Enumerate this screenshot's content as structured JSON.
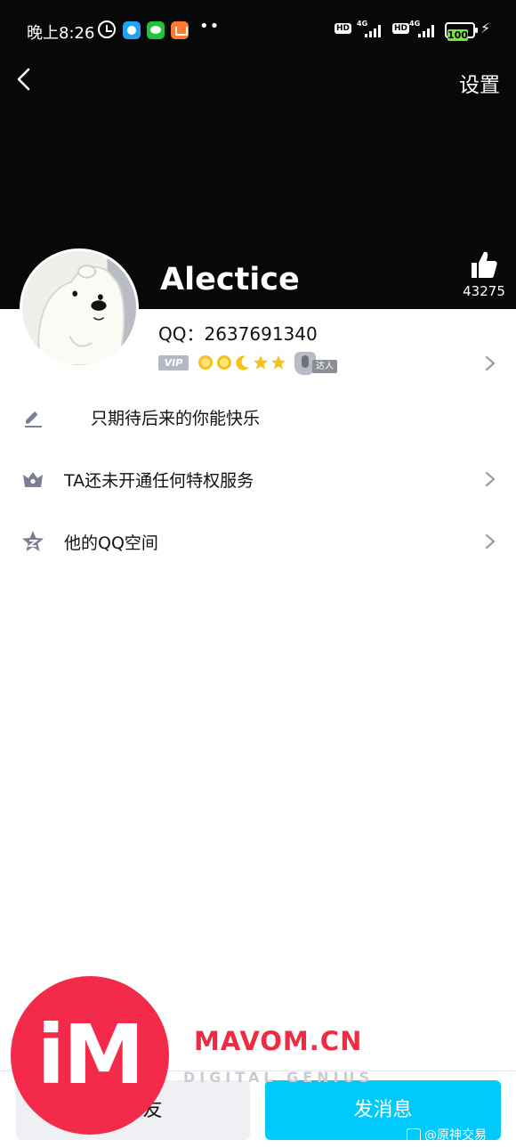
{
  "status_bar": {
    "time": "晚上8:26",
    "hd_label": "HD",
    "network_label": "4G",
    "battery": "100",
    "notification_apps": [
      "qq-icon",
      "wechat-icon",
      "mi-store-icon"
    ]
  },
  "nav": {
    "settings_label": "设置"
  },
  "profile": {
    "nickname": "Alectice",
    "qq_number": "QQ：2637691340",
    "like_count": "43275",
    "vip_label": "VIP",
    "expert_label": "达人",
    "level_icons": [
      "sun-icon",
      "sun-icon",
      "moon-icon",
      "star-icon",
      "star-icon"
    ]
  },
  "rows": {
    "signature": "只期待后来的你能快乐",
    "privilege": "TA还未开通任何特权服务",
    "qzone": "他的QQ空间"
  },
  "actions": {
    "add_friend_label": "加好友",
    "send_message_label": "发消息"
  },
  "watermark": {
    "logo_text": "iM",
    "site": "MAVOM.CN",
    "tagline": "DIGITAL GENIUS",
    "weibo_handle": "@原神交易"
  },
  "colors": {
    "header_bg": "#070908",
    "accent": "#00cafc",
    "watermark_red": "#f42a4a"
  }
}
